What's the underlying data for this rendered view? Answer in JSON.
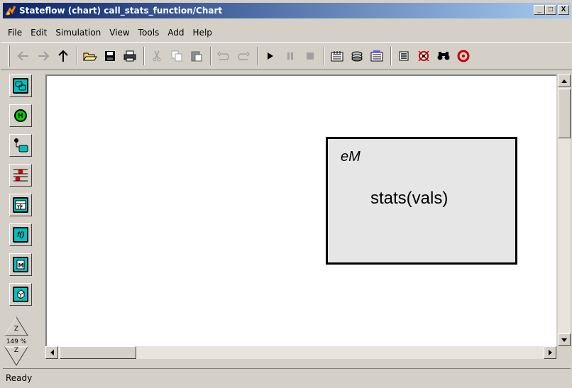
{
  "window": {
    "title": "Stateflow (chart) call_stats_function/Chart",
    "minimize_label": "_",
    "maximize_label": "□",
    "close_label": "X"
  },
  "menu": {
    "items": [
      {
        "label": "File"
      },
      {
        "label": "Edit"
      },
      {
        "label": "Simulation"
      },
      {
        "label": "View"
      },
      {
        "label": "Tools"
      },
      {
        "label": "Add"
      },
      {
        "label": "Help"
      }
    ]
  },
  "toolbar": {
    "icons": [
      "back-icon",
      "forward-icon",
      "up-icon",
      "open-icon",
      "save-icon",
      "print-icon",
      "cut-icon",
      "copy-icon",
      "paste-icon",
      "undo-icon",
      "redo-icon",
      "play-icon",
      "pause-icon",
      "stop-icon",
      "build-icon",
      "rebuild-icon",
      "incremental-build-icon",
      "explorer-icon",
      "debugger-icon",
      "find-icon",
      "parent-icon"
    ]
  },
  "palette": {
    "tools": [
      "state-tool",
      "history-junction-tool",
      "default-transition-tool",
      "connective-junction-tool",
      "truth-table-tool",
      "graphical-function-tool",
      "embedded-matlab-tool",
      "box-tool"
    ],
    "history_letter": "H",
    "function_letter": "f()",
    "zoom_label": "149 %",
    "zoom_in_label": "Z",
    "zoom_out_label": "Z"
  },
  "canvas": {
    "block": {
      "label": "eM",
      "body": "stats(vals)"
    }
  },
  "status": {
    "text": "Ready"
  },
  "colors": {
    "window_bg": "#d4d0c8",
    "title_gradient_start": "#0a246a",
    "title_gradient_end": "#a6caf0",
    "palette_cyan": "#00c0c0",
    "palette_green": "#00d000",
    "block_fill": "#e6e6e6",
    "stop_red": "#c00000"
  }
}
